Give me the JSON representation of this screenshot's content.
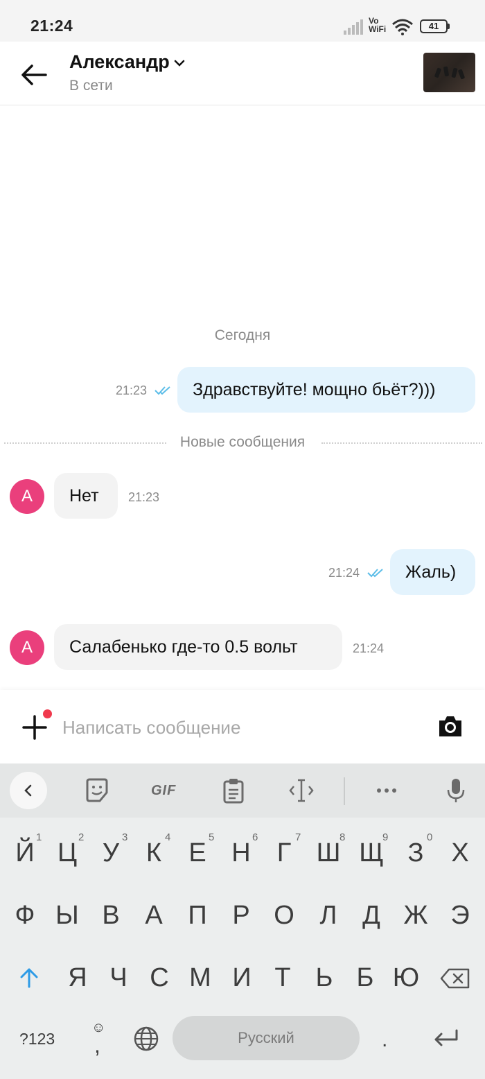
{
  "status_bar": {
    "time": "21:24",
    "network_label_1": "Vo",
    "network_label_2": "WiFi",
    "battery": "41"
  },
  "header": {
    "contact_name": "Александр",
    "status": "В сети"
  },
  "chat": {
    "date_separator": "Сегодня",
    "new_messages_separator": "Новые сообщения",
    "messages": [
      {
        "direction": "out",
        "text": "Здравствуйте! мощно бьёт?)))",
        "time": "21:23",
        "read": true
      },
      {
        "direction": "in",
        "sender_initial": "А",
        "text": "Нет",
        "time": "21:23"
      },
      {
        "direction": "out",
        "text": "Жаль)",
        "time": "21:24",
        "read": true
      },
      {
        "direction": "in",
        "sender_initial": "А",
        "text": "Салабенько где-то 0.5 вольт",
        "time": "21:24"
      }
    ]
  },
  "composer": {
    "placeholder": "Написать сообщение"
  },
  "keyboard": {
    "gif_label": "GIF",
    "row1": [
      "Й",
      "Ц",
      "У",
      "К",
      "Е",
      "Н",
      "Г",
      "Ш",
      "Щ",
      "З",
      "Х"
    ],
    "row1_hints": [
      "1",
      "2",
      "3",
      "4",
      "5",
      "6",
      "7",
      "8",
      "9",
      "0"
    ],
    "row2": [
      "Ф",
      "Ы",
      "В",
      "А",
      "П",
      "Р",
      "О",
      "Л",
      "Д",
      "Ж",
      "Э"
    ],
    "row3": [
      "Я",
      "Ч",
      "С",
      "М",
      "И",
      "Т",
      "Ь",
      "Б",
      "Ю"
    ],
    "symbols_key": "?123",
    "comma_key": ",",
    "space_label": "Русский",
    "period_key": ".",
    "accent_color": "#2e9be6"
  },
  "colors": {
    "outgoing_bubble": "#e3f3fd",
    "incoming_bubble": "#f3f3f3",
    "avatar": "#ea3f7c",
    "notification_dot": "#f0394d"
  }
}
